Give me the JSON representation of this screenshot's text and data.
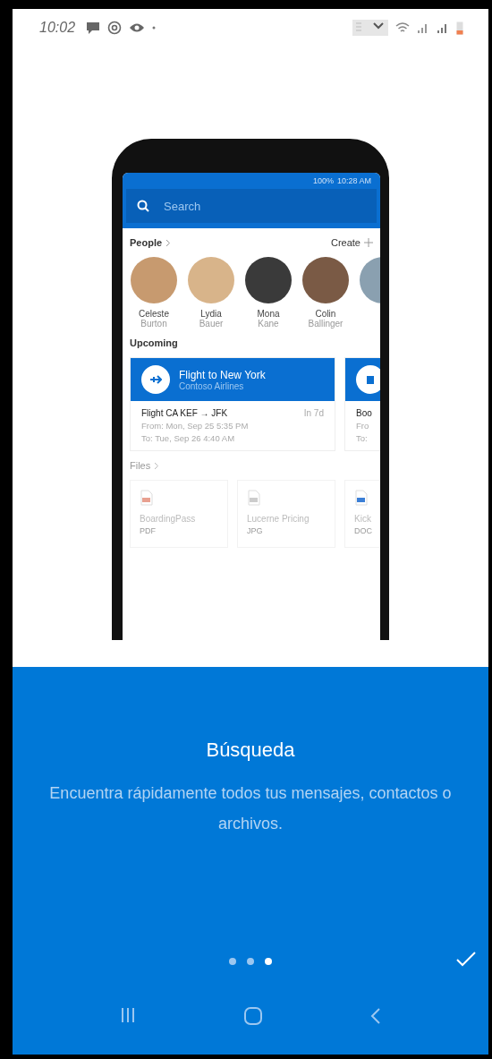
{
  "status_bar": {
    "time": "10:02"
  },
  "mockup": {
    "status": {
      "battery": "100%",
      "time": "10:28 AM"
    },
    "search": {
      "placeholder": "Search"
    },
    "people": {
      "title": "People",
      "action": "Create",
      "items": [
        {
          "first": "Celeste",
          "last": "Burton"
        },
        {
          "first": "Lydia",
          "last": "Bauer"
        },
        {
          "first": "Mona",
          "last": "Kane"
        },
        {
          "first": "Colin",
          "last": "Ballinger"
        }
      ]
    },
    "upcoming": {
      "title": "Upcoming",
      "cards": [
        {
          "kind": "flight",
          "title": "Flight to New York",
          "subtitle": "Contoso Airlines",
          "heading": "Flight CA KEF → JFK",
          "when": "In 7d",
          "lines": [
            "From: Mon, Sep 25 5:35 PM",
            "To: Tue, Sep 26 4:40 AM"
          ]
        },
        {
          "kind": "other",
          "heading": "Boo",
          "lines": [
            "Fro",
            "To:"
          ]
        }
      ]
    },
    "files": {
      "title": "Files",
      "items": [
        {
          "kind": "pdf",
          "name": "BoardingPass",
          "type": "PDF"
        },
        {
          "kind": "image",
          "name": "Lucerne Pricing",
          "type": "JPG"
        },
        {
          "kind": "doc",
          "name": "Kick",
          "type": "DOC"
        }
      ]
    }
  },
  "onboarding": {
    "title": "Búsqueda",
    "description": "Encuentra rápidamente todos tus mensajes, contactos o archivos.",
    "dots": [
      {
        "selected": false
      },
      {
        "selected": false
      },
      {
        "selected": true
      }
    ]
  }
}
